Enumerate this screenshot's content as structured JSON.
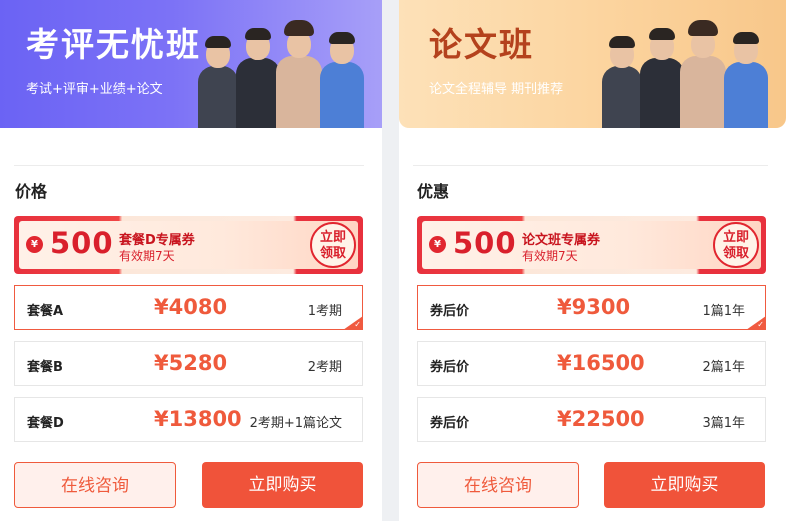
{
  "cards": [
    {
      "banner": {
        "title": "考评无忧班",
        "subtitle": "考试+评审+业绩+论文"
      },
      "section_title": "价格",
      "coupon": {
        "currency": "¥",
        "amount": "500",
        "name": "套餐D专属券",
        "validity": "有效期7天",
        "claim_label": "立即领取"
      },
      "rows": [
        {
          "label": "套餐A",
          "price": "¥4080",
          "term": "1考期",
          "selected": true
        },
        {
          "label": "套餐B",
          "price": "¥5280",
          "term": "2考期",
          "selected": false
        },
        {
          "label": "套餐D",
          "price": "¥13800",
          "term": "2考期+1篇论文",
          "selected": false
        }
      ],
      "buttons": {
        "consult": "在线咨询",
        "buy": "立即购买"
      }
    },
    {
      "banner": {
        "title": "论文班",
        "subtitle": "论文全程辅导 期刊推荐"
      },
      "section_title": "优惠",
      "coupon": {
        "currency": "¥",
        "amount": "500",
        "name": "论文班专属券",
        "validity": "有效期7天",
        "claim_label": "立即领取"
      },
      "rows": [
        {
          "label": "券后价",
          "price": "¥9300",
          "term": "1篇1年",
          "selected": true
        },
        {
          "label": "券后价",
          "price": "¥16500",
          "term": "2篇1年",
          "selected": false
        },
        {
          "label": "券后价",
          "price": "¥22500",
          "term": "3篇1年",
          "selected": false
        }
      ],
      "buttons": {
        "consult": "在线咨询",
        "buy": "立即购买"
      }
    }
  ],
  "colors": {
    "accent": "#ef5a3c",
    "coupon_red": "#e1262f",
    "left_banner": "#7c72f6",
    "right_banner": "#fcd5a0",
    "right_title": "#b4421d"
  }
}
